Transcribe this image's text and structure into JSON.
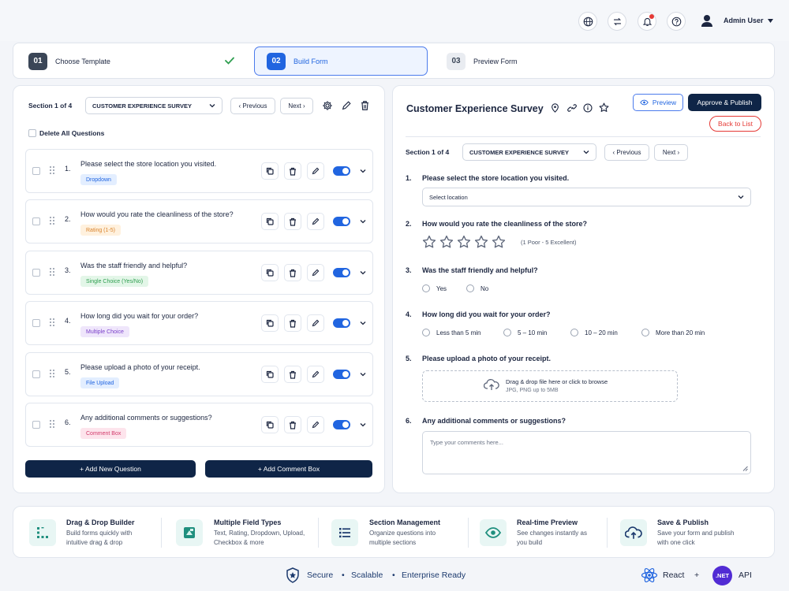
{
  "topbar": {
    "icons": [
      "globe-icon",
      "switch-icon",
      "bell-icon",
      "help-icon"
    ],
    "user_name": "Admin User"
  },
  "steps": [
    {
      "num": "01",
      "label": "Choose Template",
      "state": "done"
    },
    {
      "num": "02",
      "label": "Build Form",
      "state": "active"
    },
    {
      "num": "03",
      "label": "Preview Form",
      "state": "todo"
    }
  ],
  "builder": {
    "section_label": "Section 1 of 4",
    "section_select": "CUSTOMER EXPERIENCE SURVEY",
    "prev_label": "‹ Previous",
    "next_label": "Next ›",
    "delete_all_label": "Delete All Questions",
    "questions": [
      {
        "num": "1.",
        "text": "Please select the store location you visited.",
        "tag": "Dropdown",
        "tag_bg": "#e3eeff",
        "tag_fg": "#2165e0"
      },
      {
        "num": "2.",
        "text": "How would you rate the cleanliness of the store?",
        "tag": "Rating (1-5)",
        "tag_bg": "#fff1de",
        "tag_fg": "#d9822b"
      },
      {
        "num": "3.",
        "text": "Was the staff friendly and helpful?",
        "tag": "Single Choice (Yes/No)",
        "tag_bg": "#e3f6e8",
        "tag_fg": "#2e9e4f"
      },
      {
        "num": "4.",
        "text": "How long did you wait for your order?",
        "tag": "Multiple Choice",
        "tag_bg": "#efe6fb",
        "tag_fg": "#7a3fc9"
      },
      {
        "num": "5.",
        "text": "Please upload a photo of your receipt.",
        "tag": "File Upload",
        "tag_bg": "#e3eeff",
        "tag_fg": "#2165e0"
      },
      {
        "num": "6.",
        "text": "Any additional comments or suggestions?",
        "tag": "Comment Box",
        "tag_bg": "#fde4ec",
        "tag_fg": "#d23a6b"
      }
    ],
    "add_question_label": "+ Add New Question",
    "add_comment_label": "+ Add Comment Box"
  },
  "preview": {
    "title": "Customer Experience Survey",
    "preview_label": "Preview",
    "publish_label": "Approve & Publish",
    "back_label": "Back to List",
    "section_label": "Section 1 of 4",
    "section_select": "CUSTOMER EXPERIENCE SURVEY",
    "prev_label": "‹ Previous",
    "next_label": "Next ›",
    "q1": {
      "num": "1.",
      "text": "Please select the store location you visited.",
      "placeholder": "Select location"
    },
    "q2": {
      "num": "2.",
      "text": "How would you rate the cleanliness of the store?",
      "hint": "(1 Poor - 5 Excellent)",
      "stars": 5
    },
    "q3": {
      "num": "3.",
      "text": "Was the staff friendly and helpful?",
      "options": [
        "Yes",
        "No"
      ]
    },
    "q4": {
      "num": "4.",
      "text": "How long did you wait for your order?",
      "options": [
        "Less than 5 min",
        "5 – 10 min",
        "10 – 20 min",
        "More than 20 min"
      ]
    },
    "q5": {
      "num": "5.",
      "text": "Please upload a photo of your receipt.",
      "drop_text": "Drag & drop file here or click to browse",
      "drop_hint": "JPG, PNG up to 5MB"
    },
    "q6": {
      "num": "6.",
      "text": "Any additional comments or suggestions?",
      "placeholder": "Type your comments here..."
    }
  },
  "features": [
    {
      "icon": "drag-drop-icon",
      "title": "Drag & Drop Builder",
      "desc": "Build forms quickly with intuitive drag & drop"
    },
    {
      "icon": "field-types-icon",
      "title": "Multiple Field Types",
      "desc": "Text, Rating, Dropdown, Upload, Checkbox & more"
    },
    {
      "icon": "list-icon",
      "title": "Section Management",
      "desc": "Organize questions into multiple sections"
    },
    {
      "icon": "eye-icon",
      "title": "Real-time Preview",
      "desc": "See changes instantly as you build"
    },
    {
      "icon": "cloud-upload-icon",
      "title": "Save & Publish",
      "desc": "Save your form and publish with one click"
    }
  ],
  "footer": {
    "secure": "Secure",
    "scalable": "Scalable",
    "enterprise": "Enterprise Ready",
    "dot": "•",
    "react": "React",
    "plus": "+",
    "net_badge": ".NET",
    "api": "API"
  },
  "colors": {
    "primary": "#2165e0",
    "navy": "#0f2547",
    "success": "#2e9e4f",
    "danger": "#e53935"
  }
}
